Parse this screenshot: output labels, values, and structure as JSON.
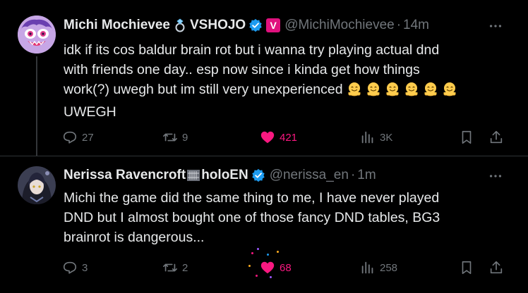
{
  "tweets": [
    {
      "display_name": "Michi Mochievee",
      "org_tag": "VSHOJO",
      "affiliate_badge": "V",
      "handle": "@MichiMochievee",
      "time": "14m",
      "text_lines": [
        "idk if its cos baldur brain rot but i wanna try playing actual dnd",
        "with friends one day.. esp now since i kinda get how things",
        "work(?) uwegh but im still very unexperienced",
        "UWEGH"
      ],
      "emoji_count": 6,
      "replies": "27",
      "retweets": "9",
      "likes": "421",
      "views": "3K",
      "liked": true
    },
    {
      "display_name": "Nerissa Ravencroft",
      "org_tag": "holoEN",
      "handle": "@nerissa_en",
      "time": "1m",
      "text_lines": [
        "Michi the game did the same thing to me, I have never played",
        "DND but I almost bought one of those fancy DND tables, BG3",
        "brainrot is dangerous..."
      ],
      "replies": "3",
      "retweets": "2",
      "likes": "68",
      "views": "258",
      "liked": true
    }
  ],
  "colors": {
    "background": "#000000",
    "text": "#e7e9ea",
    "muted": "#71767b",
    "like": "#f91880",
    "verified": "#1d9bf0",
    "divider": "#2f3336"
  },
  "icons": [
    "reply-icon",
    "retweet-icon",
    "heart-icon",
    "views-icon",
    "bookmark-icon",
    "share-icon",
    "more-icon",
    "verified-icon",
    "ring-icon",
    "bars-icon",
    "smiling-face-icon"
  ]
}
